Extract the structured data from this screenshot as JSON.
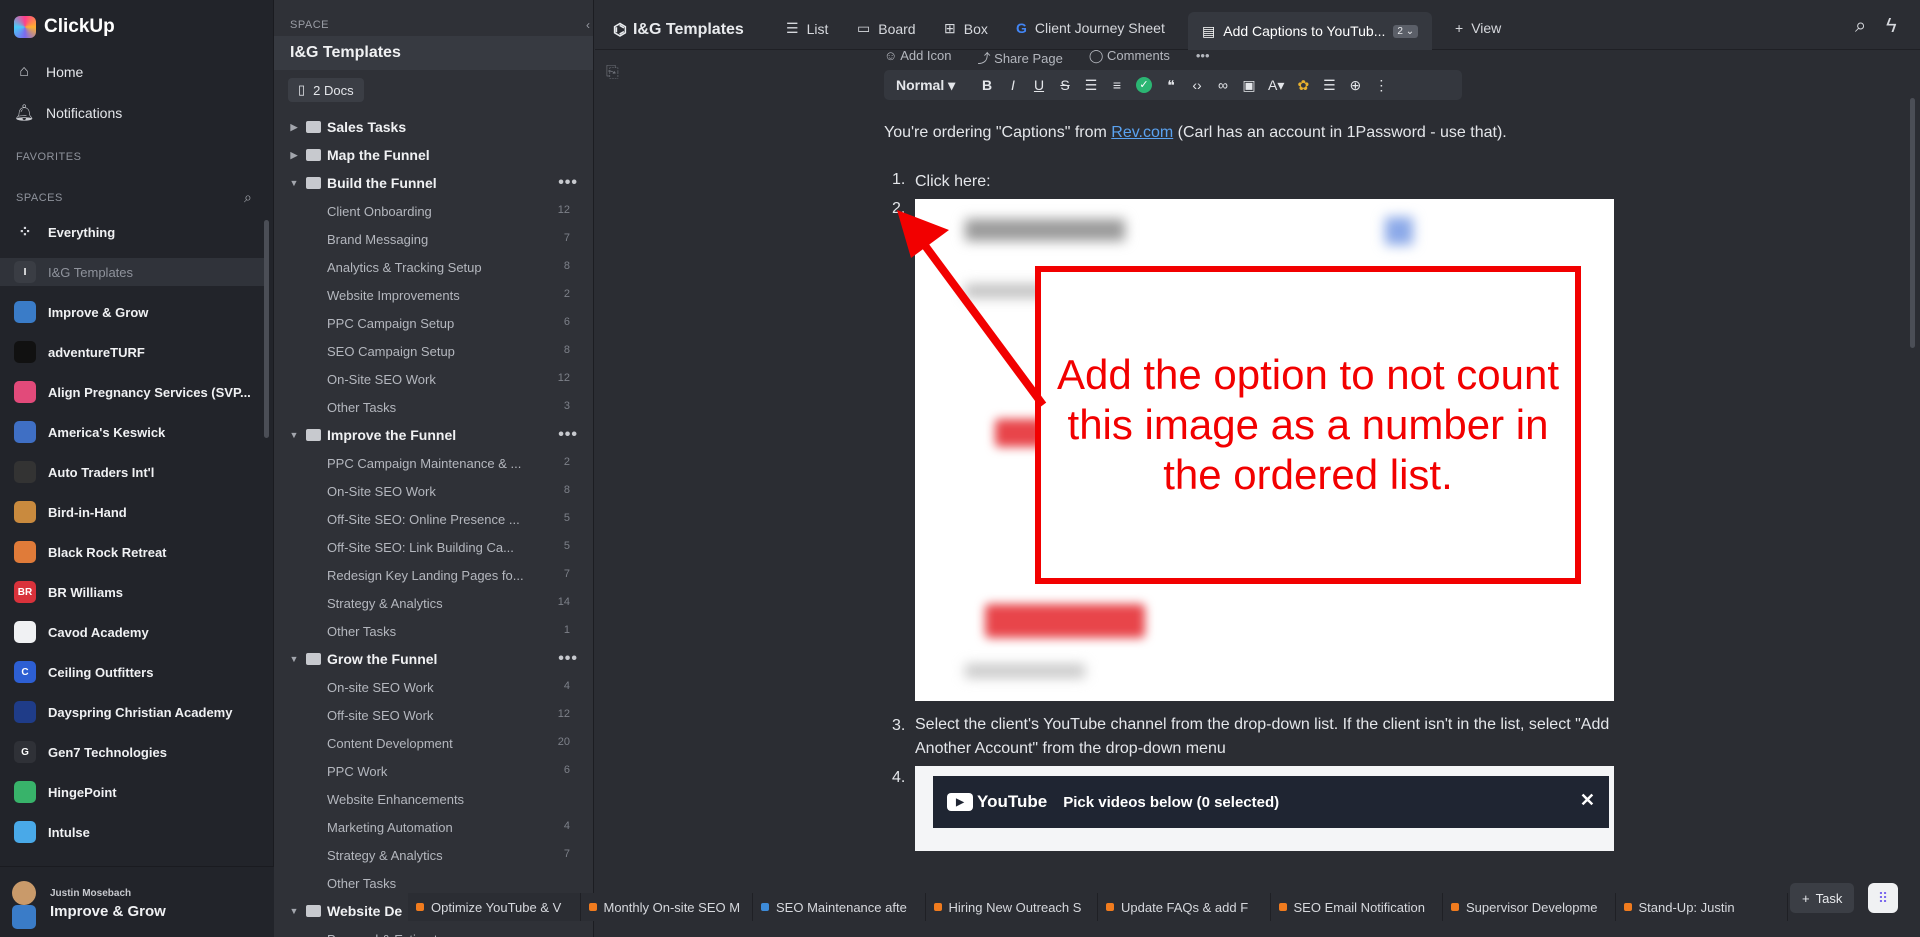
{
  "app": {
    "logo_text": "ClickUp"
  },
  "rail": {
    "home": "Home",
    "notifications": "Notifications",
    "favorites_label": "FAVORITES",
    "spaces_label": "SPACES",
    "spaces": [
      {
        "label": "Everything",
        "avatar": "",
        "color": "#22242a"
      },
      {
        "label": "I&G Templates",
        "avatar": "I",
        "color": "#3a3d44"
      },
      {
        "label": "Improve & Grow",
        "avatar": "",
        "color": "#3a7cc8"
      },
      {
        "label": "adventureTURF",
        "avatar": "",
        "color": "#111111"
      },
      {
        "label": "Align Pregnancy Services (SVP...",
        "avatar": "",
        "color": "#e24a7a"
      },
      {
        "label": "America's Keswick",
        "avatar": "",
        "color": "#3f6fc4"
      },
      {
        "label": "Auto Traders Int'l",
        "avatar": "",
        "color": "#333333"
      },
      {
        "label": "Bird-in-Hand",
        "avatar": "",
        "color": "#c98a3e"
      },
      {
        "label": "Black Rock Retreat",
        "avatar": "",
        "color": "#e07b39"
      },
      {
        "label": "BR Williams",
        "avatar": "BR",
        "color": "#d9323b"
      },
      {
        "label": "Cavod Academy",
        "avatar": "",
        "color": "#f0f1f3"
      },
      {
        "label": "Ceiling Outfitters",
        "avatar": "C",
        "color": "#2d5fd3"
      },
      {
        "label": "Dayspring Christian Academy",
        "avatar": "",
        "color": "#1f3c88"
      },
      {
        "label": "Gen7 Technologies",
        "avatar": "G",
        "color": "#2f3137"
      },
      {
        "label": "HingePoint",
        "avatar": "",
        "color": "#38b36a"
      },
      {
        "label": "Intulse",
        "avatar": "",
        "color": "#49a9e8"
      }
    ],
    "user_name": "Justin Mosebach",
    "user_space": "Improve & Grow"
  },
  "tree": {
    "space_tag": "SPACE",
    "title": "I&G Templates",
    "docs": "2 Docs",
    "folders": [
      {
        "label": "Sales Tasks",
        "expanded": false,
        "lists": []
      },
      {
        "label": "Map the Funnel",
        "expanded": false,
        "lists": []
      },
      {
        "label": "Build the Funnel",
        "expanded": true,
        "lists": [
          {
            "label": "Client Onboarding",
            "count": "12"
          },
          {
            "label": "Brand Messaging",
            "count": "7"
          },
          {
            "label": "Analytics & Tracking Setup",
            "count": "8"
          },
          {
            "label": "Website Improvements",
            "count": "2"
          },
          {
            "label": "PPC Campaign Setup",
            "count": "6"
          },
          {
            "label": "SEO Campaign Setup",
            "count": "8"
          },
          {
            "label": "On-Site SEO Work",
            "count": "12"
          },
          {
            "label": "Other Tasks",
            "count": "3"
          }
        ]
      },
      {
        "label": "Improve the Funnel",
        "expanded": true,
        "lists": [
          {
            "label": "PPC Campaign Maintenance & ...",
            "count": "2"
          },
          {
            "label": "On-Site SEO Work",
            "count": "8"
          },
          {
            "label": "Off-Site SEO: Online Presence ...",
            "count": "5"
          },
          {
            "label": "Off-Site SEO: Link Building Ca...",
            "count": "5"
          },
          {
            "label": "Redesign Key Landing Pages fo...",
            "count": "7"
          },
          {
            "label": "Strategy & Analytics",
            "count": "14"
          },
          {
            "label": "Other Tasks",
            "count": "1"
          }
        ]
      },
      {
        "label": "Grow the Funnel",
        "expanded": true,
        "lists": [
          {
            "label": "On-site SEO Work",
            "count": "4"
          },
          {
            "label": "Off-site SEO Work",
            "count": "12"
          },
          {
            "label": "Content Development",
            "count": "20"
          },
          {
            "label": "PPC Work",
            "count": "6"
          },
          {
            "label": "Website Enhancements",
            "count": ""
          },
          {
            "label": "Marketing Automation",
            "count": "4"
          },
          {
            "label": "Strategy & Analytics",
            "count": "7"
          },
          {
            "label": "Other Tasks",
            "count": ""
          }
        ]
      },
      {
        "label": "Website De",
        "expanded": true,
        "lists": [
          {
            "label": "Proposal & Estimate",
            "count": ""
          }
        ]
      }
    ]
  },
  "topbar": {
    "breadcrumb": "I&G Templates",
    "tabs": [
      {
        "label": "List",
        "icon": "list-icon"
      },
      {
        "label": "Board",
        "icon": "board-icon"
      },
      {
        "label": "Box",
        "icon": "box-icon"
      },
      {
        "label": "Client Journey Sheet",
        "icon": "google-icon"
      }
    ],
    "active_tab": "Add Captions to YouTub...",
    "active_badge": "2",
    "add_view": "View"
  },
  "doc": {
    "actions": [
      "Add Icon",
      "Share Page",
      "Comments"
    ],
    "style_select": "Normal",
    "intro_before": "You're ordering \"Captions\" from ",
    "intro_link": "Rev.com",
    "intro_after": " (Carl has an account in 1Password - use that).",
    "items": [
      {
        "num": "1.",
        "text": "Click here:"
      },
      {
        "num": "2.",
        "text": ""
      },
      {
        "num": "3.",
        "text": "Select the client's YouTube channel from the drop-down list. If the client isn't in the list, select \"Add Another Account\" from the drop-down menu"
      },
      {
        "num": "4.",
        "text": ""
      }
    ],
    "callout_text": "Add the option to not count this image as a number in the ordered list.",
    "yt_logo": "YouTube",
    "yt_title": "Pick videos below (0 selected)"
  },
  "tray": [
    {
      "label": "Optimize YouTube & V",
      "color": "#f07b1e"
    },
    {
      "label": "Monthly On-site SEO M",
      "color": "#f07b1e"
    },
    {
      "label": "SEO Maintenance afte",
      "color": "#3d8bd9"
    },
    {
      "label": "Hiring New Outreach S",
      "color": "#f07b1e"
    },
    {
      "label": "Update FAQs & add F",
      "color": "#f07b1e"
    },
    {
      "label": "SEO Email Notification",
      "color": "#f07b1e"
    },
    {
      "label": "Supervisor Developme",
      "color": "#f07b1e"
    },
    {
      "label": "Stand-Up: Justin",
      "color": "#f07b1e"
    }
  ],
  "task_button": "Task"
}
